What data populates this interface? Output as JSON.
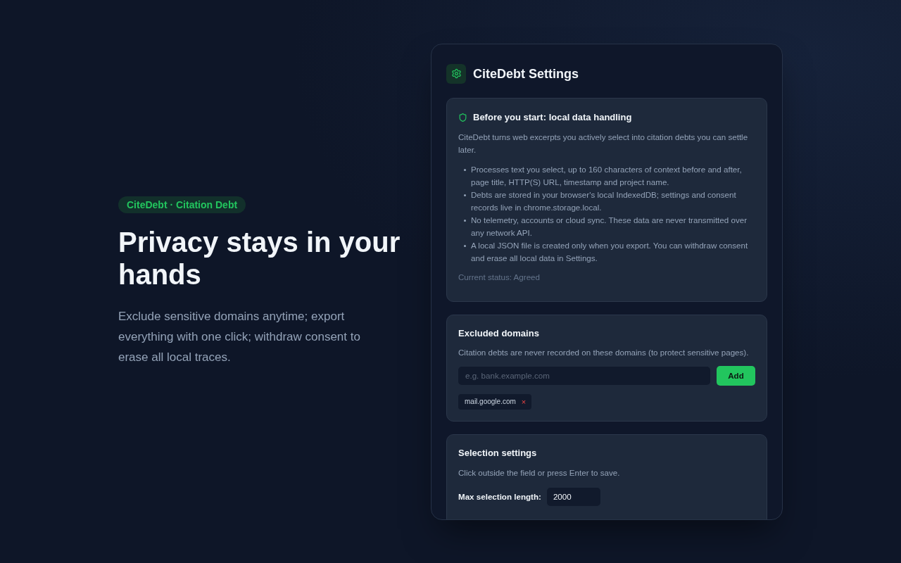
{
  "hero": {
    "badge": "CiteDebt · Citation Debt",
    "title": "Privacy stays in your hands",
    "description": "Exclude sensitive domains anytime; export everything with one click; withdraw consent to erase all local traces."
  },
  "settings_panel": {
    "title": "CiteDebt Settings",
    "consent_card": {
      "title": "Before you start: local data handling",
      "intro": "CiteDebt turns web excerpts you actively select into citation debts you can settle later.",
      "items": [
        "Processes text you select, up to 160 characters of context before and after, page title, HTTP(S) URL, timestamp and project name.",
        "Debts are stored in your browser's local IndexedDB; settings and consent records live in chrome.storage.local.",
        "No telemetry, accounts or cloud sync. These data are never transmitted over any network API.",
        "A local JSON file is created only when you export. You can withdraw consent and erase all local data in Settings."
      ],
      "status": "Current status: Agreed"
    },
    "excluded_domains": {
      "title": "Excluded domains",
      "description": "Citation debts are never recorded on these domains (to protect sensitive pages).",
      "input": {
        "placeholder": "e.g. bank.example.com"
      },
      "add_button": "Add",
      "domains": [
        {
          "name": "mail.google.com",
          "remove": "×"
        }
      ]
    },
    "selection_settings": {
      "title": "Selection settings",
      "hint": "Click outside the field or press Enter to save.",
      "fields": [
        {
          "label": "Max selection length:",
          "value": "2000"
        }
      ]
    }
  }
}
